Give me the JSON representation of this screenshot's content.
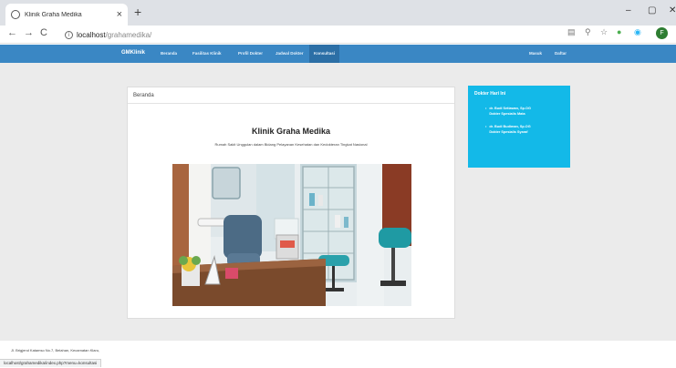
{
  "browser": {
    "tab_title": "Klinik Graha Medika",
    "tab_close": "×",
    "new_tab": "+",
    "window_controls": [
      "–",
      "▢",
      "✕"
    ],
    "nav_icons": [
      "←",
      "→",
      "C"
    ],
    "url_host": "localhost",
    "url_path": "/grahamedika/",
    "profile_initial": "F"
  },
  "navbar": {
    "brand": "GMKlinik",
    "links": [
      "Beranda",
      "Fasilitas Klinik",
      "Profil Dokter",
      "Jadwal Dokter",
      "Konsultasi"
    ],
    "active_link": "Konsultasi",
    "right_links": [
      "Masuk",
      "Daftar"
    ]
  },
  "content": {
    "panel_heading": "Beranda",
    "site_title": "Klinik Graha Medika",
    "tagline": "Rumah Sakit Unggulan dalam Bidang Pelayanan Kesehatan dan Kedokteran Tingkat Nasional"
  },
  "sidebar": {
    "title": "Dokter Hari Ini",
    "doctors": [
      {
        "name": "dr. Budi Setiawan, Sp.OG",
        "role": "Dokter Spesialis Mata"
      },
      {
        "name": "dr. Budi Budiman, Sp.OG",
        "role": "Dokter Spesialis Syaraf"
      }
    ]
  },
  "footer": {
    "address": "Jl. Brigjend Katamso No.7, Belahan, Kecamatan Klaru,"
  },
  "status_url": "localhost/grahamedika/index.php?menu=konsultasi",
  "colors": {
    "navbar": "#3a87c4",
    "navbar_active": "#2c6fa6",
    "sidebar_card": "#13b9e8",
    "page_background": "#ebebeb"
  }
}
